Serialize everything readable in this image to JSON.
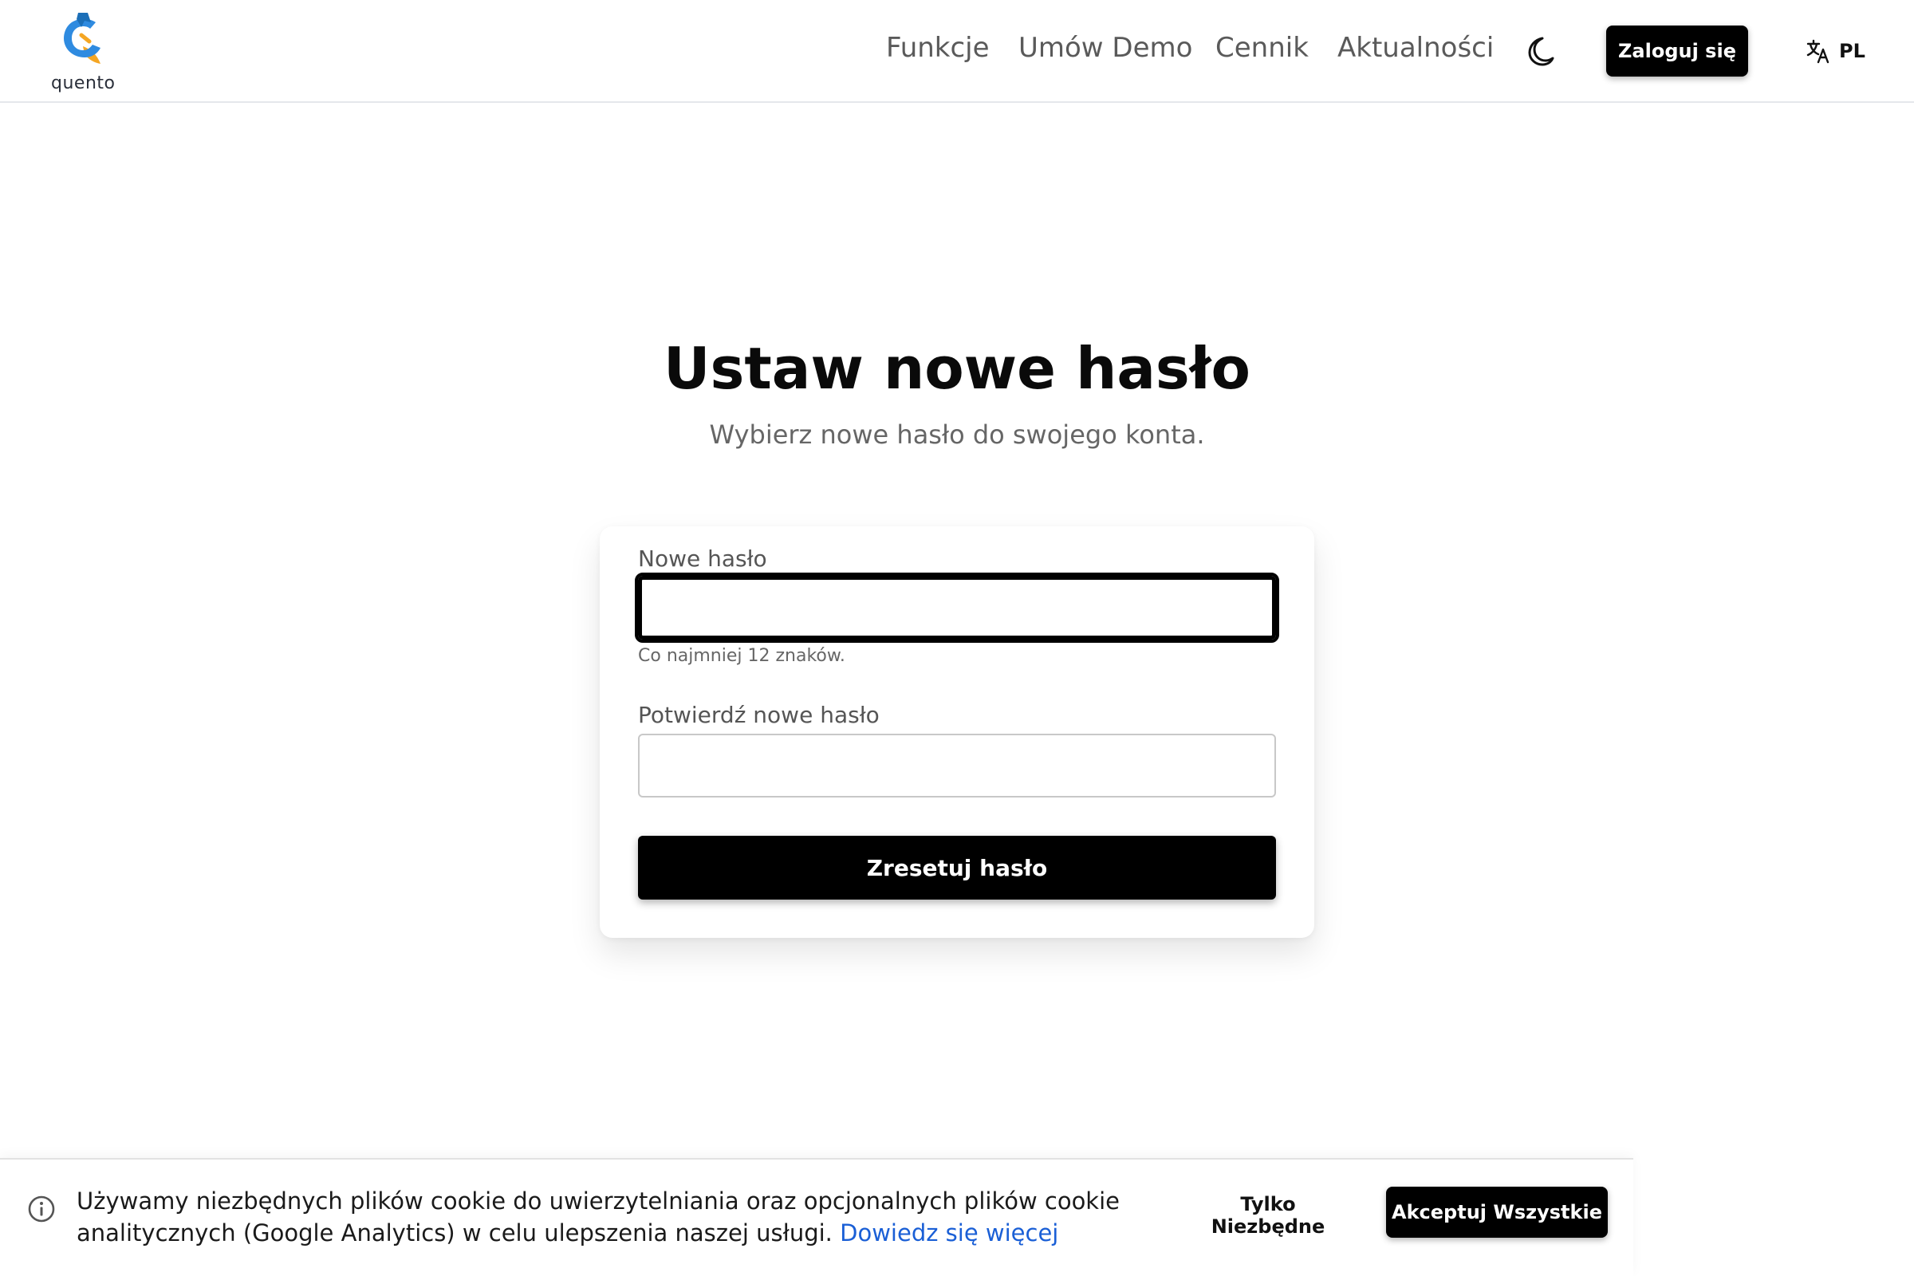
{
  "brand": {
    "name": "quento",
    "colors": {
      "blue": "#2f8be0",
      "orange": "#f5a623",
      "dark": "#1c3f6e"
    }
  },
  "nav": {
    "links": [
      "Funkcje",
      "Umów Demo",
      "Cennik",
      "Aktualności"
    ],
    "theme_icon": "moon-icon",
    "login_label": "Zaloguj się",
    "language_icon": "translate-icon",
    "language_code": "PL"
  },
  "main": {
    "title": "Ustaw nowe hasło",
    "subtitle": "Wybierz nowe hasło do swojego konta.",
    "form": {
      "new_password_label": "Nowe hasło",
      "new_password_value": "",
      "new_password_hint": "Co najmniej 12 znaków.",
      "confirm_password_label": "Potwierdź nowe hasło",
      "confirm_password_value": "",
      "submit_label": "Zresetuj hasło"
    }
  },
  "cookie_banner": {
    "icon": "info-icon",
    "text": "Używamy niezbędnych plików cookie do uwierzytelniania oraz opcjonalnych plików cookie analitycznych (Google Analytics) w celu ulepszenia naszej usługi.",
    "link_label": "Dowiedz się więcej",
    "necessary_label": "Tylko Niezbędne",
    "accept_label": "Akceptuj Wszystkie",
    "link_color": "#1a5fd6"
  }
}
